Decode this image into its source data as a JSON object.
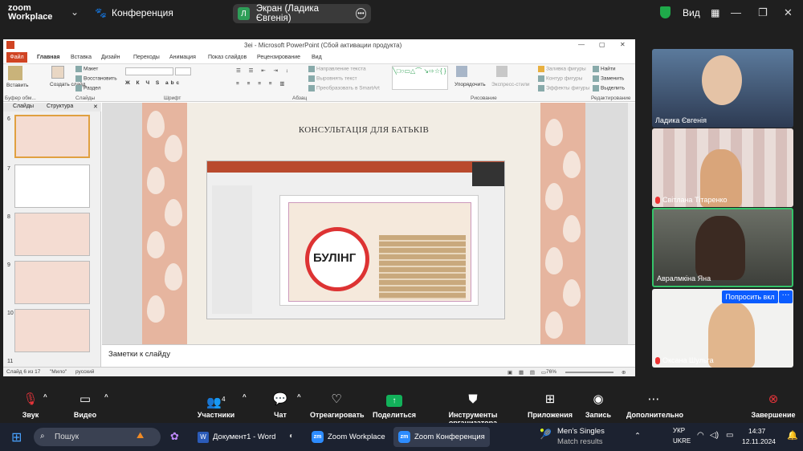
{
  "zoom": {
    "logo_line1": "zoom",
    "logo_line2": "Workplace",
    "meeting_label": "Конференция",
    "share_tab_initial": "Л",
    "share_tab_label": "Экран (Ладика Євгенія)",
    "view_label": "Вид"
  },
  "ppt": {
    "window_title": "3ei - Microsoft PowerPoint (Сбой активации продукта)",
    "tabs": [
      "Файл",
      "Главная",
      "Вставка",
      "Дизайн",
      "Переходы",
      "Анимация",
      "Показ слайдов",
      "Рецензирование",
      "Вид"
    ],
    "ribbon": {
      "paste": "Вставить",
      "clipboard": "Буфер обм...",
      "create_slide": "Создать слайд",
      "layout": "Макет",
      "restore": "Восстановить",
      "section": "Раздел",
      "slides_group": "Слайды",
      "font_group": "Шрифт",
      "paragraph_group": "Абзац",
      "text_direction": "Направление текста",
      "align_text": "Выровнять текст",
      "smartart": "Преобразовать в SmartArt",
      "arrange": "Упорядочить",
      "quick_styles": "Экспресс-стили",
      "drawing_group": "Рисование",
      "fill": "Заливка фигуры",
      "outline": "Контур фигуры",
      "effects": "Эффекты фигуры",
      "find": "Найти",
      "replace": "Заменить",
      "select": "Выделить",
      "editing_group": "Редактирование"
    },
    "panel_tabs": [
      "Слайды",
      "Структура"
    ],
    "slide_numbers": [
      "6",
      "7",
      "8",
      "9",
      "10",
      "11"
    ],
    "slide_title": "КОНСУЛЬТАЦІЯ ДЛЯ БАТЬКІВ",
    "inner_word": "БУЛІНГ",
    "notes_placeholder": "Заметки к слайду",
    "status": {
      "slide_of": "Слайд 6 из 17",
      "theme": "\"Мило\"",
      "lang": "русский",
      "zoom": "76%"
    }
  },
  "participants": [
    {
      "name": "Ладика Євгенія",
      "muted": false
    },
    {
      "name": "Світлана Тітаренко",
      "muted": true
    },
    {
      "name": "Авралмкіна Яна",
      "muted": false
    },
    {
      "name": "Оксана Шульга",
      "muted": true
    }
  ],
  "ask_button": "Попросить вкл",
  "toolbar": {
    "mute": "Звук",
    "video": "Видео",
    "participants": "Участники",
    "participants_count": "4",
    "chat": "Чат",
    "react": "Отреагировать",
    "share": "Поделиться",
    "host_tools": "Инструменты организатора",
    "apps": "Приложения",
    "record": "Запись",
    "more": "Дополнительно",
    "end": "Завершение"
  },
  "taskbar": {
    "search_placeholder": "Пошук",
    "apps": [
      "Документ1 - Word",
      "Zoom Workplace",
      "Zoom Конференция"
    ],
    "notification_title": "Men's Singles",
    "notification_sub": "Match results",
    "lang1": "УКР",
    "lang2": "UKRE",
    "time": "14:37",
    "date": "12.11.2024"
  },
  "colors": {
    "zoom_blue": "#0b5cff",
    "share_green": "#12b15a",
    "end_red": "#e5343a",
    "ppt_file_tab": "#d04423",
    "slide_leaf": "#e6b59f"
  }
}
